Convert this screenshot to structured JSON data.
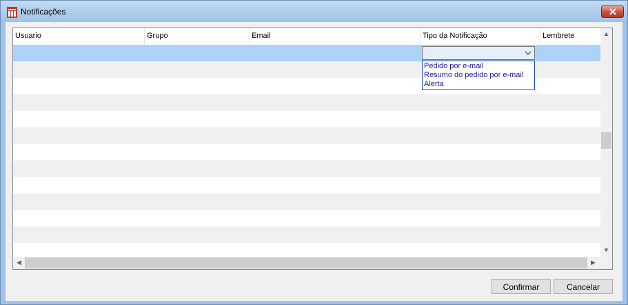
{
  "window": {
    "title": "Notificações",
    "app_icon": "app-logo-icon",
    "close_icon": "close-icon"
  },
  "grid": {
    "columns": [
      "Usuario",
      "Grupo",
      "Email",
      "Tipo da Notificação",
      "Lembrete"
    ],
    "selected_row": 0,
    "row_count": 12
  },
  "combo": {
    "selected": "",
    "options": [
      "Pedido por e-mail",
      "Resumo do pedido por e-mail",
      "Alerta"
    ]
  },
  "buttons": {
    "confirm_label": "Confirmar",
    "cancel_label": "Cancelar"
  },
  "colors": {
    "selection": "#add2f7",
    "titlebar": "#9fc2e6",
    "alt_row": "#f0f0f0",
    "close": "#c7513c"
  }
}
